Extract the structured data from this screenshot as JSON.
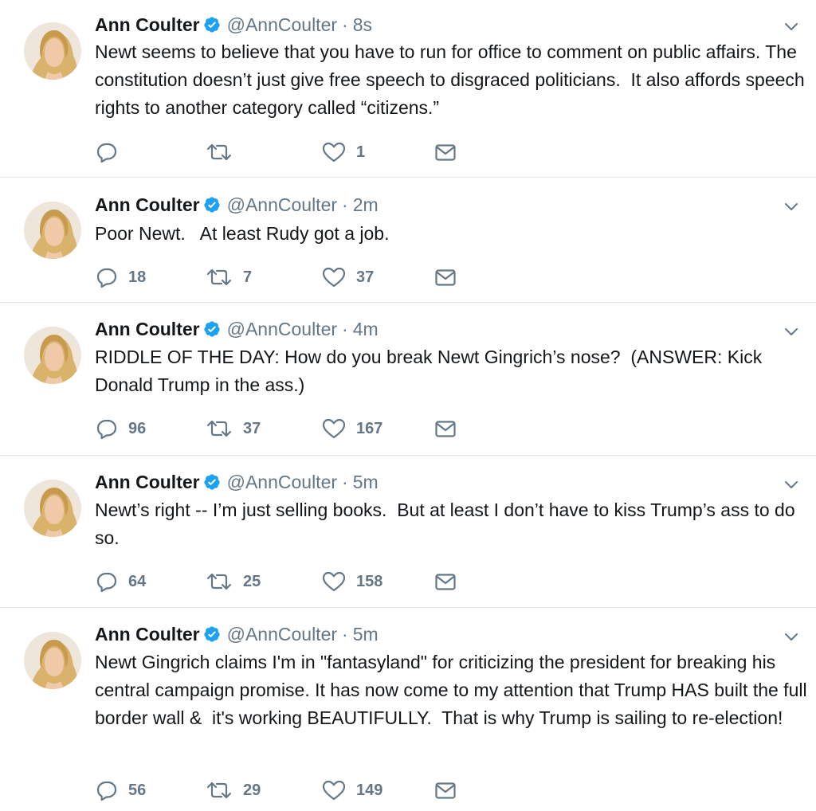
{
  "tweets": [
    {
      "name": "Ann Coulter",
      "handle": "@AnnCoulter",
      "sep": "·",
      "time": "8s",
      "text": "Newt seems to believe that you have to run for office to comment on public affairs. The constitution doesn’t just give free speech to disgraced politicians.  It also affords speech rights to another category called “citizens.”",
      "replies": "",
      "retweets": "",
      "likes": "1"
    },
    {
      "name": "Ann Coulter",
      "handle": "@AnnCoulter",
      "sep": "·",
      "time": "2m",
      "text": "Poor Newt.   At least Rudy got a job.",
      "replies": "18",
      "retweets": "7",
      "likes": "37"
    },
    {
      "name": "Ann Coulter",
      "handle": "@AnnCoulter",
      "sep": "·",
      "time": "4m",
      "text": "RIDDLE OF THE DAY: How do you break Newt Gingrich’s nose?  (ANSWER: Kick Donald Trump in the ass.)",
      "replies": "96",
      "retweets": "37",
      "likes": "167"
    },
    {
      "name": "Ann Coulter",
      "handle": "@AnnCoulter",
      "sep": "·",
      "time": "5m",
      "text": "Newt’s right -- I’m just selling books.  But at least I don’t have to kiss Trump’s ass to do so.",
      "replies": "64",
      "retweets": "25",
      "likes": "158"
    },
    {
      "name": "Ann Coulter",
      "handle": "@AnnCoulter",
      "sep": "·",
      "time": "5m",
      "text": "Newt Gingrich claims I'm in \"fantasyland\" for criticizing the president for breaking his central campaign promise. It has now come to my attention that Trump HAS built the full border wall &  it's working BEAUTIFULLY.  That is why Trump is sailing to re-election!",
      "replies": "56",
      "retweets": "29",
      "likes": "149"
    }
  ],
  "icons": {
    "verified": "verified-badge-icon",
    "caret": "chevron-down-icon",
    "reply": "reply-icon",
    "retweet": "retweet-icon",
    "like": "heart-icon",
    "dm": "envelope-icon"
  },
  "colors": {
    "verified": "#1da1f2",
    "meta_gray": "#657786",
    "text": "#14171a",
    "divider": "#e1e8ed"
  }
}
